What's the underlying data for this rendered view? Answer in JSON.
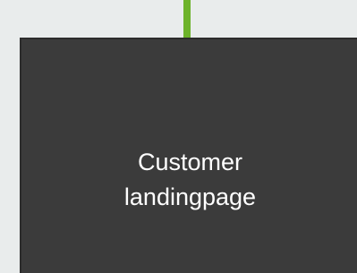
{
  "diagram": {
    "node": {
      "label_line1": "Customer",
      "label_line2": "landingpage"
    },
    "arrow": {
      "direction": "down",
      "color": "#6db32a"
    },
    "colors": {
      "background": "#e9ecec",
      "node_fill": "#3b3b3b",
      "node_text": "#ffffff"
    }
  }
}
